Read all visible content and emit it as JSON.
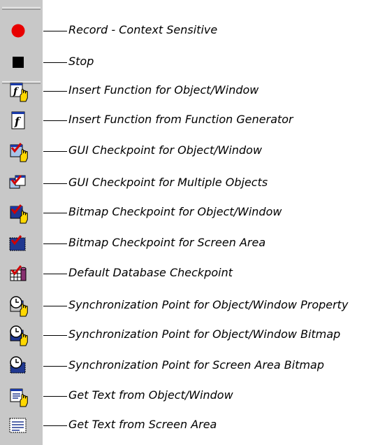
{
  "toolbar": {
    "tools": [
      {
        "label": "Record - Context Sensitive",
        "icon": "record-dot-icon"
      },
      {
        "label": "Stop",
        "icon": "stop-square-icon"
      },
      {
        "label": "Insert Function for Object/Window",
        "icon": "insert-function-object-icon"
      },
      {
        "label": "Insert Function from Function Generator",
        "icon": "function-generator-icon"
      },
      {
        "label": "GUI Checkpoint for Object/Window",
        "icon": "gui-checkpoint-object-icon"
      },
      {
        "label": "GUI Checkpoint for Multiple Objects",
        "icon": "gui-checkpoint-multiple-icon"
      },
      {
        "label": "Bitmap Checkpoint for Object/Window",
        "icon": "bitmap-checkpoint-object-icon"
      },
      {
        "label": "Bitmap Checkpoint for Screen Area",
        "icon": "bitmap-checkpoint-area-icon"
      },
      {
        "label": "Default Database Checkpoint",
        "icon": "database-checkpoint-icon"
      },
      {
        "label": "Synchronization Point for Object/Window Property",
        "icon": "sync-property-icon"
      },
      {
        "label": "Synchronization Point for Object/Window Bitmap",
        "icon": "sync-bitmap-icon"
      },
      {
        "label": "Synchronization Point for Screen Area Bitmap",
        "icon": "sync-area-bitmap-icon"
      },
      {
        "label": "Get Text from Object/Window",
        "icon": "get-text-object-icon"
      },
      {
        "label": "Get Text from Screen Area",
        "icon": "get-text-area-icon"
      }
    ]
  },
  "colors": {
    "toolbar_bg": "#c8c8c8",
    "record_red": "#e80000",
    "checkmark_red": "#d00000",
    "hand_yellow": "#ffd800",
    "window_blue": "#1838a8"
  }
}
